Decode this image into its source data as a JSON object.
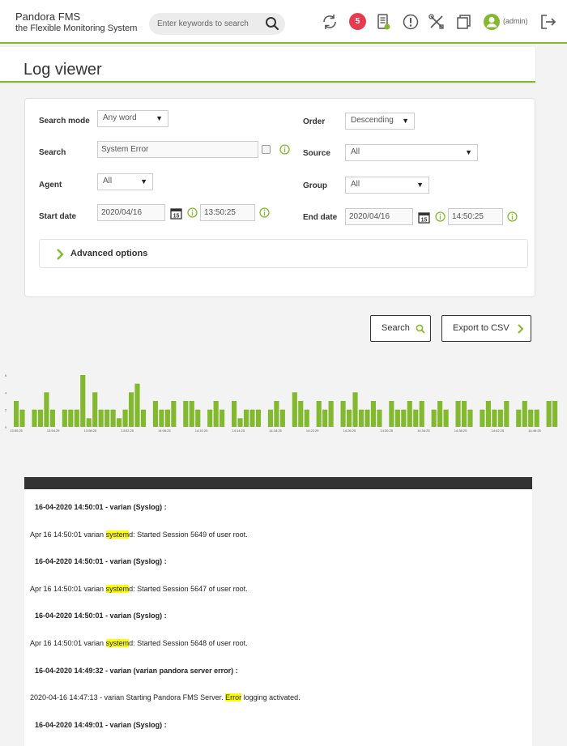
{
  "header": {
    "brand_name": "Pandora FMS",
    "brand_tagline": "the Flexible Monitoring System",
    "search_placeholder": "Enter keywords to search",
    "notifications_count": "5",
    "user_label": "(admin)",
    "icons": [
      "refresh-icon",
      "notification-badge",
      "server-status-icon",
      "alert-icon",
      "tools-icon",
      "windows-icon",
      "user-avatar-icon",
      "logout-icon"
    ],
    "accent_color": "#82b92e",
    "badge_color": "#e63c52"
  },
  "page": {
    "title": "Log viewer"
  },
  "form": {
    "search_mode": {
      "label": "Search mode",
      "value": "Any word"
    },
    "order": {
      "label": "Order",
      "value": "Descending"
    },
    "search": {
      "label": "Search",
      "value": "System Error"
    },
    "source": {
      "label": "Source",
      "value": "All"
    },
    "agent": {
      "label": "Agent",
      "value": "All"
    },
    "group": {
      "label": "Group",
      "value": "All"
    },
    "start_date": {
      "label": "Start date",
      "date": "2020/04/16",
      "time": "13:50:25"
    },
    "end_date": {
      "label": "End date",
      "date": "2020/04/16",
      "time": "14:50:25"
    },
    "advanced_label": "Advanced options"
  },
  "buttons": {
    "search_label": "Search",
    "export_label": "Export to CSV"
  },
  "chart_data": {
    "type": "bar",
    "color": "#82b92e",
    "ylim": [
      0,
      6
    ],
    "y_ticks": [
      "0",
      "2",
      "4",
      "6"
    ],
    "x_tick_labels": [
      "13:50:25",
      "13:54:25",
      "13:58:25",
      "14:02:25",
      "14:06:25",
      "14:10:25",
      "14:14:25",
      "14:18:25",
      "14:22:25",
      "14:26:25",
      "14:30:25",
      "14:34:25",
      "14:38:25",
      "14:42:25",
      "14:46:25"
    ],
    "values": [
      3,
      2,
      0,
      2,
      2,
      4,
      2,
      0,
      2,
      2,
      2,
      6,
      1,
      4,
      2,
      2,
      2,
      1,
      2,
      4,
      5,
      2,
      0,
      3,
      2,
      2,
      3,
      0,
      3,
      3,
      2,
      0,
      2,
      3,
      2,
      0,
      3,
      1,
      2,
      2,
      2,
      0,
      2,
      3,
      2,
      0,
      4,
      3,
      2,
      0,
      3,
      2,
      3,
      0,
      3,
      2,
      4,
      2,
      2,
      3,
      2,
      0,
      3,
      2,
      2,
      3,
      2,
      3,
      0,
      2,
      3,
      2,
      0,
      3,
      3,
      2,
      0,
      2,
      3,
      2,
      2,
      3,
      0,
      2,
      3,
      2,
      2,
      0,
      3,
      3,
      0
    ]
  },
  "logs": [
    {
      "head": "16-04-2020 14:50:01 - varian (Syslog) :",
      "msg_pre": "Apr 16 14:50:01 varian ",
      "msg_hl": "system",
      "msg_post": "d: Started Session 5649 of user root."
    },
    {
      "head": "16-04-2020 14:50:01 - varian (Syslog) :",
      "msg_pre": "Apr 16 14:50:01 varian ",
      "msg_hl": "system",
      "msg_post": "d: Started Session 5647 of user root."
    },
    {
      "head": "16-04-2020 14:50:01 - varian (Syslog) :",
      "msg_pre": "Apr 16 14:50:01 varian ",
      "msg_hl": "system",
      "msg_post": "d: Started Session 5648 of user root."
    },
    {
      "head": "16-04-2020 14:49:32 - varian (varian pandora server error) :",
      "msg_pre": "2020-04-16 14:47:13 - varian Starting Pandora FMS Server. ",
      "msg_hl": "Error",
      "msg_post": " logging activated."
    },
    {
      "head": "16-04-2020 14:49:01 - varian (Syslog) :",
      "msg_pre": "",
      "msg_hl": "",
      "msg_post": ""
    }
  ]
}
